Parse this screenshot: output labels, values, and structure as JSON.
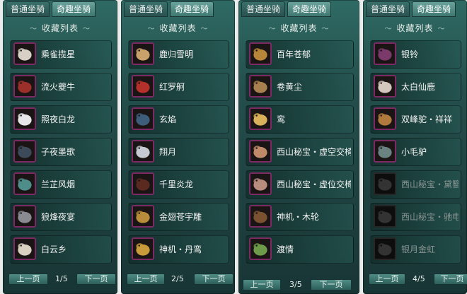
{
  "tabs": {
    "normal": "普通坐骑",
    "fun": "奇趣坐骑"
  },
  "list_title": "收藏列表",
  "pager": {
    "prev": "上一页",
    "next": "下一页"
  },
  "panels": [
    {
      "page": "1/5",
      "items": [
        {
          "name": "乘雀揽星",
          "icon": "bird-mount-icon",
          "color": "#d8cfc6"
        },
        {
          "name": "流火夔牛",
          "icon": "bull-mount-icon",
          "color": "#9b2f2a"
        },
        {
          "name": "照夜白龙",
          "icon": "white-dragon-icon",
          "color": "#e7e7ea"
        },
        {
          "name": "子夜墨歌",
          "icon": "ink-horse-icon",
          "color": "#3c4a5a"
        },
        {
          "name": "兰芷风烟",
          "icon": "smoke-beast-icon",
          "color": "#4f8d8a"
        },
        {
          "name": "狼烽夜宴",
          "icon": "wolf-mount-icon",
          "color": "#8a8a92"
        },
        {
          "name": "白云乡",
          "icon": "cloud-mount-icon",
          "color": "#d9d0c2"
        }
      ]
    },
    {
      "page": "2/5",
      "items": [
        {
          "name": "鹿归雪明",
          "icon": "deer-mount-icon",
          "color": "#c9a16a"
        },
        {
          "name": "红罗舸",
          "icon": "red-boat-icon",
          "color": "#b3312a"
        },
        {
          "name": "玄焰",
          "icon": "dark-flame-icon",
          "color": "#3d5d7a"
        },
        {
          "name": "翔月",
          "icon": "moon-bird-icon",
          "color": "#c8cad3"
        },
        {
          "name": "千里炎龙",
          "icon": "flame-dragon-icon",
          "color": "#5a2a20"
        },
        {
          "name": "金翅苍宇雕",
          "icon": "golden-eagle-icon",
          "color": "#b78c3a"
        },
        {
          "name": "神机・丹鸾",
          "icon": "phoenix-icon",
          "color": "#c99a3a"
        }
      ]
    },
    {
      "page": "3/5",
      "items": [
        {
          "name": "百年苍郁",
          "icon": "tree-mount-icon",
          "color": "#b7863a"
        },
        {
          "name": "卷黄尘",
          "icon": "dust-horse-icon",
          "color": "#a87f4e"
        },
        {
          "name": "鸾",
          "icon": "luan-bird-icon",
          "color": "#d9b15a"
        },
        {
          "name": "西山秘宝・虚空交椅",
          "icon": "old-man-icon",
          "color": "#c08a6a"
        },
        {
          "name": "西山秘宝・虚位交椅",
          "icon": "lady-icon",
          "color": "#b98d7e"
        },
        {
          "name": "神机・木轮",
          "icon": "wood-wheel-icon",
          "color": "#7a5232"
        },
        {
          "name": "渡情",
          "icon": "boat-icon",
          "color": "#6d9b4a"
        }
      ]
    },
    {
      "page": "4/5",
      "items": [
        {
          "name": "银铃",
          "icon": "silver-bell-beast-icon",
          "color": "#7a3a6a",
          "disabled": false
        },
        {
          "name": "太白仙鹿",
          "icon": "immortal-deer-icon",
          "color": "#d4c8be",
          "disabled": false
        },
        {
          "name": "双峰驼・祥祥",
          "icon": "camel-icon",
          "color": "#b07a3e",
          "disabled": false
        },
        {
          "name": "小毛驴",
          "icon": "donkey-icon",
          "color": "#6a8282",
          "disabled": false
        },
        {
          "name": "西山秘宝・黛簪鸾",
          "icon": "locked-mount-icon",
          "color": "#555",
          "disabled": true
        },
        {
          "name": "西山秘宝・驰电骏",
          "icon": "locked-mount-icon",
          "color": "#555",
          "disabled": true
        },
        {
          "name": "银月金虹",
          "icon": "locked-mount-icon",
          "color": "#555",
          "disabled": true
        }
      ]
    }
  ]
}
